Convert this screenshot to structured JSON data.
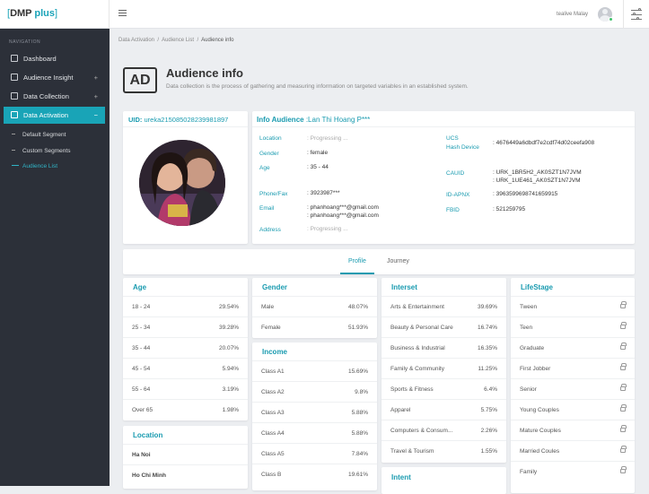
{
  "app": {
    "logo_open": "[",
    "logo_main": "DMP",
    "logo_plus": "plus",
    "logo_close": "]"
  },
  "header": {
    "user_name": "tealive Malay"
  },
  "sidebar": {
    "section_label": "NAVIGATION",
    "items": [
      {
        "label": "Dashboard",
        "icon": "home-icon"
      },
      {
        "label": "Audience Insight",
        "icon": "chart-icon",
        "expand": "+"
      },
      {
        "label": "Data Collection",
        "icon": "collection-icon",
        "expand": "+"
      },
      {
        "label": "Data Activation",
        "icon": "activation-icon",
        "expand": "−"
      }
    ],
    "subitems": [
      {
        "label": "Default Segment"
      },
      {
        "label": "Custom Segments"
      },
      {
        "label": "Audience List"
      }
    ]
  },
  "breadcrumb": {
    "a": "Data Activation",
    "b": "Audience List",
    "c": "Audience info",
    "sep": "/"
  },
  "page": {
    "badge": "AD",
    "title": "Audience info",
    "description": "Data collection is the process of gathering and measuring information on targeted variables in an established system."
  },
  "uid": {
    "label": "UID:",
    "value": "ureka215085028239981897"
  },
  "info": {
    "title_label": "Info Audience",
    "title_value": ":Lan Thi Hoang P***",
    "location_label": "Location",
    "location_value": ": Progressing ...",
    "gender_label": "Gender",
    "gender_value": ": female",
    "age_label": "Age",
    "age_value": ": 35 - 44",
    "phone_label": "Phone/Fax",
    "phone_value": ": 3923987***",
    "email_label": "Email",
    "email_value1": ": phanhoang***@gmail.com",
    "email_value2": ": phanhoang***@gmail.com",
    "address_label": "Address",
    "address_value": ": Progressing ...",
    "ucs_label": "UCS",
    "hash_label": "Hash Device",
    "hash_value": ": 4676449a6dbdf7e2cdf74d02ceefa908",
    "cauid_label": "CAUID",
    "cauid_value1": ": URK_1BR5H2_AK0SZT1N7JVM",
    "cauid_value2": ": URK_1UE461_AK0SZT1N7JVM",
    "apnx_label": "ID-APNX",
    "apnx_value": ": 3963599698741659915",
    "fbid_label": "FBID",
    "fbid_value": ": 521259795"
  },
  "tabs": [
    {
      "label": "Profile"
    },
    {
      "label": "Journey"
    }
  ],
  "age": {
    "title": "Age",
    "rows": [
      {
        "name": "18 - 24",
        "value": "29.54%"
      },
      {
        "name": "25 - 34",
        "value": "39.28%"
      },
      {
        "name": "35 - 44",
        "value": "20.07%"
      },
      {
        "name": "45 - 54",
        "value": "5.94%"
      },
      {
        "name": "55 - 64",
        "value": "3.19%"
      },
      {
        "name": "Over 65",
        "value": "1.98%"
      }
    ]
  },
  "location": {
    "title": "Location",
    "rows": [
      {
        "name": "Ha Noi"
      },
      {
        "name": "Ho Chi Minh"
      }
    ]
  },
  "gender": {
    "title": "Gender",
    "rows": [
      {
        "name": "Male",
        "value": "48.07%"
      },
      {
        "name": "Female",
        "value": "51.93%"
      }
    ]
  },
  "income": {
    "title": "Income",
    "rows": [
      {
        "name": "Class A1",
        "value": "15.69%"
      },
      {
        "name": "Class A2",
        "value": "9.8%"
      },
      {
        "name": "Class A3",
        "value": "5.88%"
      },
      {
        "name": "Class A4",
        "value": "5.88%"
      },
      {
        "name": "Class A5",
        "value": "7.84%"
      },
      {
        "name": "Class B",
        "value": "19.61%"
      }
    ]
  },
  "interest": {
    "title": "Interset",
    "rows": [
      {
        "name": "Arts & Entertainment",
        "value": "39.69%"
      },
      {
        "name": "Beauty & Personal Care",
        "value": "16.74%"
      },
      {
        "name": "Business & Industrial",
        "value": "16.35%"
      },
      {
        "name": "Family & Community",
        "value": "11.25%"
      },
      {
        "name": "Sports & Fitness",
        "value": "6.4%"
      },
      {
        "name": "Apparel",
        "value": "5.75%"
      },
      {
        "name": "Computers & Consum...",
        "value": "2.26%"
      },
      {
        "name": "Travel & Tourism",
        "value": "1.55%"
      }
    ]
  },
  "intent": {
    "title": "Intent"
  },
  "lifestage": {
    "title": "LifeStage",
    "rows": [
      {
        "name": "Tween"
      },
      {
        "name": "Teen"
      },
      {
        "name": "Graduate"
      },
      {
        "name": "First Jobber"
      },
      {
        "name": "Senior"
      },
      {
        "name": "Young Couples"
      },
      {
        "name": "Mature Couples"
      },
      {
        "name": "Married Coules"
      },
      {
        "name": "Family"
      }
    ]
  }
}
